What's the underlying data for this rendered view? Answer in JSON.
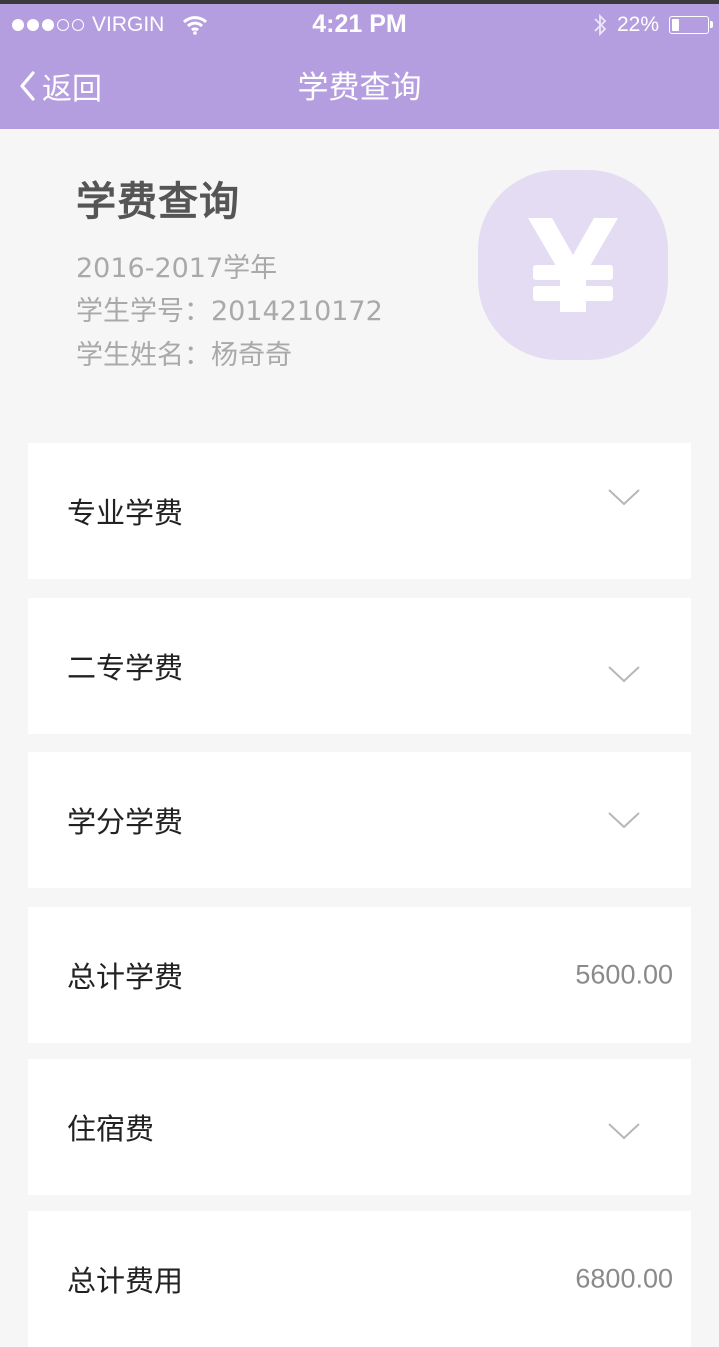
{
  "status_bar": {
    "carrier": "VIRGIN",
    "time": "4:21 PM",
    "battery": "22%",
    "battery_level": 0.22
  },
  "nav": {
    "back_label": "返回",
    "title": "学费查询"
  },
  "header": {
    "title": "学费查询",
    "year": "2016-2017学年",
    "student_id": "学生学号：2014210172",
    "student_name": "学生姓名：杨奇奇",
    "icon": "yen-icon"
  },
  "items": [
    {
      "label": "专业学费",
      "value": "",
      "icon": "chevron-down-icon"
    },
    {
      "label": "二专学费",
      "value": "",
      "icon": "chevron-down-icon"
    },
    {
      "label": "学分学费",
      "value": "",
      "icon": "chevron-down-icon"
    },
    {
      "label": "总计学费",
      "value": "5600.00"
    },
    {
      "label": "住宿费",
      "value": "",
      "icon": "chevron-down-icon"
    },
    {
      "label": "总计费用",
      "value": "6800.00"
    }
  ],
  "colors": {
    "accent": "#b59ee0",
    "badge": "#e3dcf2",
    "background": "#f6f6f6"
  }
}
